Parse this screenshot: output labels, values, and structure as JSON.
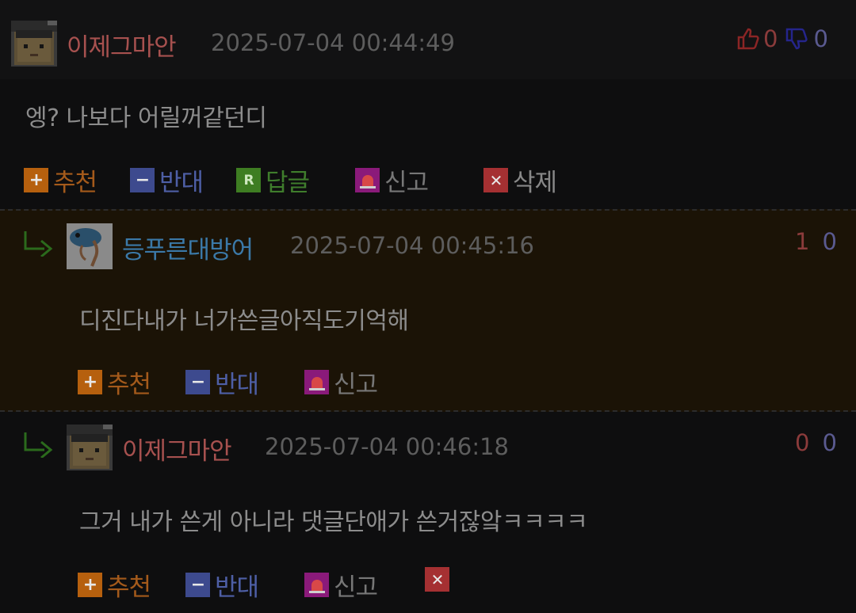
{
  "comments": [
    {
      "nickname": "이제그마안",
      "date": "2025-07-04 00:44:49",
      "up": "0",
      "down": "0",
      "text": "엥? 나보다 어릴꺼같던디",
      "actions": {
        "recommend": "추천",
        "oppose": "반대",
        "reply": "답글",
        "report": "신고",
        "delete": "삭제"
      }
    },
    {
      "nickname": "등푸른대방어",
      "date": "2025-07-04 00:45:16",
      "up": "1",
      "down": "0",
      "text": "디진다내가 너가쓴글아직도기억해",
      "actions": {
        "recommend": "추천",
        "oppose": "반대",
        "report": "신고"
      }
    },
    {
      "nickname": "이제그마안",
      "date": "2025-07-04 00:46:18",
      "up": "0",
      "down": "0",
      "text": "그거 내가 쓴게 아니라 댓글단애가 쓴거잖앜ㅋㅋㅋㅋ",
      "actions": {
        "recommend": "추천",
        "oppose": "반대",
        "report": "신고"
      }
    }
  ],
  "colors": {
    "background": "#0e0e0f",
    "highlight_bg": "#1b1306",
    "nick_red": "#a7514f",
    "nick_blue": "#3b79a8",
    "recommend": "#b6600e",
    "oppose": "#3d4a8e",
    "reply": "#3e7d22",
    "report": "#8a1a7a",
    "delete": "#a53032"
  },
  "icons": {
    "recommend": "plus-icon",
    "oppose": "minus-icon",
    "reply": "reply-R-icon",
    "report": "siren-icon",
    "delete": "x-icon",
    "thumbs_up": "thumbs-up-icon",
    "thumbs_down": "thumbs-down-icon",
    "reply_arrow": "reply-arrow-icon"
  }
}
